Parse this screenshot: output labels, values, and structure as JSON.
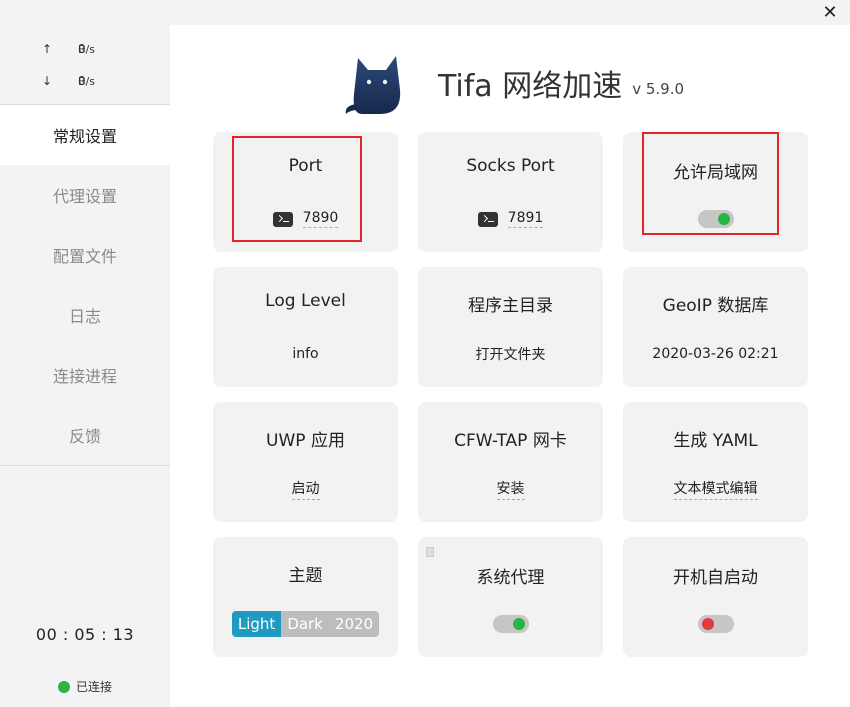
{
  "window": {
    "close_label": "✕"
  },
  "traffic": {
    "up_arrow": "↑",
    "up_value": "0",
    "up_unit": "B/s",
    "down_arrow": "↓",
    "down_value": "0",
    "down_unit": "B/s"
  },
  "nav": [
    {
      "label": "常规设置"
    },
    {
      "label": "代理设置"
    },
    {
      "label": "配置文件"
    },
    {
      "label": "日志"
    },
    {
      "label": "连接进程"
    },
    {
      "label": "反馈"
    }
  ],
  "footer": {
    "timer": "00 : 05 : 13",
    "status": "已连接"
  },
  "header": {
    "title": "Tifa 网络加速",
    "version": "v 5.9.0"
  },
  "cards": {
    "port": {
      "title": "Port",
      "value": "7890"
    },
    "socks": {
      "title": "Socks Port",
      "value": "7891"
    },
    "lan": {
      "title": "允许局域网"
    },
    "loglevel": {
      "title": "Log Level",
      "value": "info"
    },
    "home": {
      "title": "程序主目录",
      "value": "打开文件夹"
    },
    "geoip": {
      "title": "GeoIP 数据库",
      "value": "2020-03-26 02:21"
    },
    "uwp": {
      "title": "UWP 应用",
      "value": "启动"
    },
    "tap": {
      "title": "CFW-TAP 网卡",
      "value": "安装"
    },
    "yaml": {
      "title": "生成 YAML",
      "value": "文本模式编辑"
    },
    "theme": {
      "title": "主题",
      "options": [
        "Light",
        "Dark",
        "2020"
      ]
    },
    "sysproxy": {
      "title": "系统代理"
    },
    "autostart": {
      "title": "开机自启动"
    }
  },
  "colors": {
    "accent": "#1f9bc2",
    "on": "#27b443",
    "off": "#e0393e",
    "highlight": "#e6232e"
  }
}
